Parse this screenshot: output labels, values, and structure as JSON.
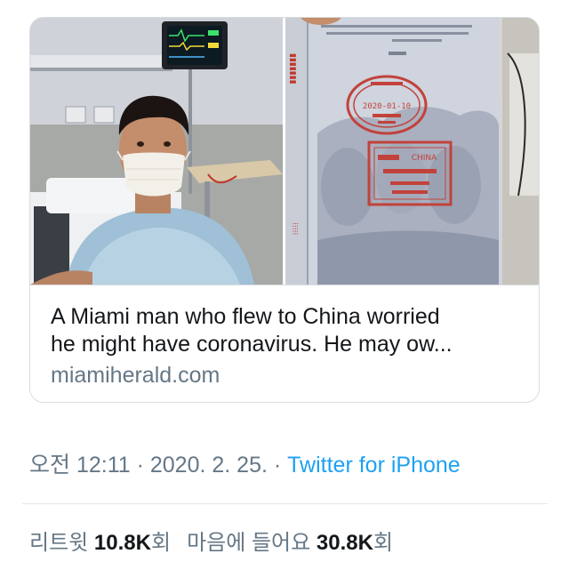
{
  "link_card": {
    "images": [
      {
        "alt": "man-in-hospital-photo"
      },
      {
        "alt": "passport-visa-stamps-photo"
      }
    ],
    "stamp_top_date": "2020-01-10",
    "stamp_bottom_text": "CHINA",
    "headline": "A Miami man who flew to China worried\nhe might have coronavirus. He may ow...",
    "domain": "miamiherald.com"
  },
  "tweet_meta": {
    "time": "오전 12:11",
    "separator": " · ",
    "date": "2020. 2. 25.",
    "separator2": " · ",
    "source": "Twitter for iPhone"
  },
  "stats": {
    "retweet_label": "리트윗",
    "retweet_count": "10.8K",
    "retweet_suffix": "회",
    "likes_label": "마음에 들어요",
    "likes_count": "30.8K",
    "likes_suffix": "회"
  },
  "colors": {
    "link_blue": "#1da1f2",
    "secondary_text": "#657786",
    "primary_text": "#14171a",
    "border": "#d9dde1"
  }
}
